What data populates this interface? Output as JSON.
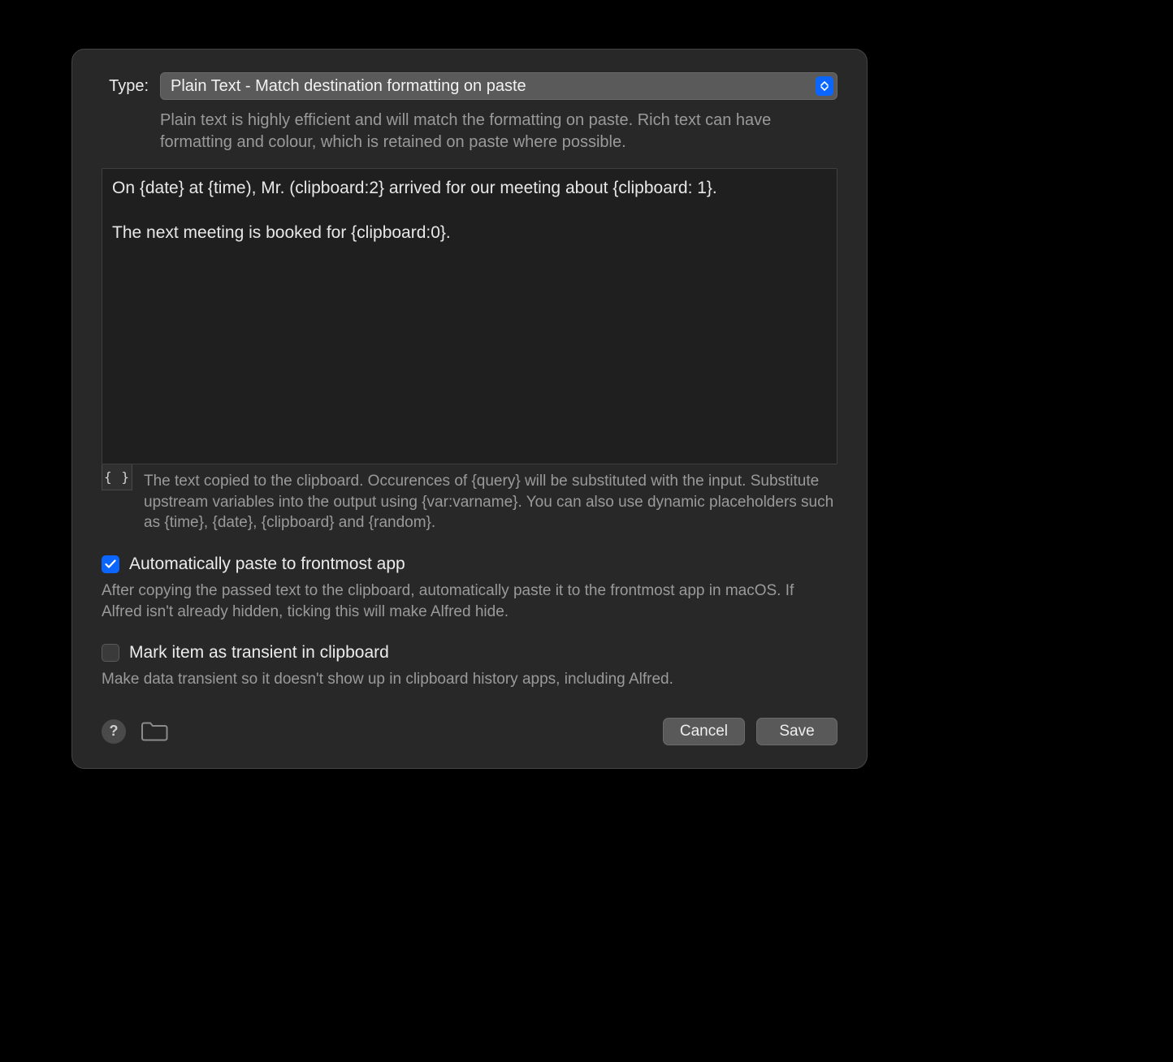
{
  "type": {
    "label": "Type:",
    "value": "Plain Text - Match destination formatting on paste",
    "description": "Plain text is highly efficient and will match the formatting on paste. Rich text can have formatting and colour, which is retained on paste where possible."
  },
  "snippet": {
    "text": "On {date} at {time), Mr. (clipboard:2} arrived for our meeting about {clipboard: 1}.\n\nThe next meeting is booked for {clipboard:0}."
  },
  "placeholders": {
    "braces_label": "{ }",
    "help": "The text copied to the clipboard. Occurences of {query} will be substituted with the input. Substitute upstream variables into the output using {var:varname}. You can also use dynamic placeholders such as {time}, {date}, {clipboard} and {random}."
  },
  "auto_paste": {
    "checked": true,
    "label": "Automatically paste to frontmost app",
    "description": "After copying the passed text to the clipboard, automatically paste it to the frontmost app in macOS. If Alfred isn't already hidden, ticking this will make Alfred hide."
  },
  "transient": {
    "checked": false,
    "label": "Mark item as transient in clipboard",
    "description": "Make data transient so it doesn't show up in clipboard history apps, including Alfred."
  },
  "footer": {
    "help_label": "?",
    "cancel": "Cancel",
    "save": "Save"
  }
}
